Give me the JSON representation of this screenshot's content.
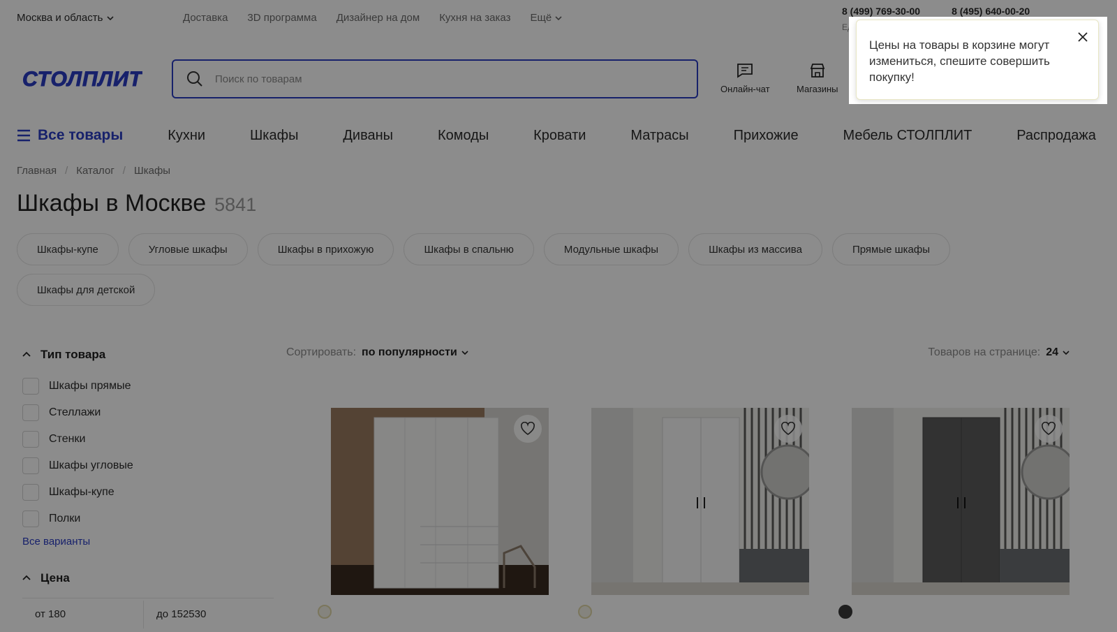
{
  "topbar": {
    "region": "Москва и область",
    "links": [
      "Доставка",
      "3D программа",
      "Дизайнер на дом",
      "Кухня на заказ"
    ],
    "more": "Ещё",
    "phones": [
      "8 (499) 769-30-00",
      "8 (495) 640-00-20"
    ],
    "phones_sub": "Ед"
  },
  "header": {
    "logo_text": "СТОЛПЛИТ",
    "search_placeholder": "Поиск по товарам",
    "actions": [
      {
        "label": "Онлайн-чат",
        "icon": "chat-icon"
      },
      {
        "label": "Магазины",
        "icon": "store-icon"
      }
    ]
  },
  "nav": {
    "all": "Все товары",
    "items": [
      "Кухни",
      "Шкафы",
      "Диваны",
      "Комоды",
      "Кровати",
      "Матрасы",
      "Прихожие",
      "Мебель СТОЛПЛИТ",
      "Распродажа"
    ]
  },
  "breadcrumb": [
    "Главная",
    "Каталог",
    "Шкафы"
  ],
  "page": {
    "title": "Шкафы в Москве",
    "count": "5841"
  },
  "chips": [
    "Шкафы-купе",
    "Угловые шкафы",
    "Шкафы в прихожую",
    "Шкафы в спальню",
    "Модульные шкафы",
    "Шкафы из массива",
    "Прямые шкафы",
    "Шкафы для детской"
  ],
  "filters": {
    "type_title": "Тип товара",
    "type_items": [
      "Шкафы прямые",
      "Стеллажи",
      "Стенки",
      "Шкафы угловые",
      "Шкафы-купе",
      "Полки"
    ],
    "all_variants": "Все варианты",
    "price_title": "Цена",
    "price_from": "от 180",
    "price_to": "до 152530"
  },
  "sort": {
    "label": "Сортировать:",
    "value": "по популярности",
    "perpage_label": "Товаров на странице:",
    "perpage_value": "24"
  },
  "products": [
    {
      "color": "#ffffff",
      "swatch": "#f3f1e6"
    },
    {
      "color": "#e9e9e9",
      "swatch": "#f3f1e6"
    },
    {
      "color": "#5a5a5a",
      "swatch": "#3a3a3a"
    }
  ],
  "toast": {
    "text": "Цены на товары в корзине могут измениться, спешите совершить покупку!"
  },
  "colors": {
    "accent": "#2b3cc4",
    "overlay": "rgba(0,0,0,0.45)"
  }
}
